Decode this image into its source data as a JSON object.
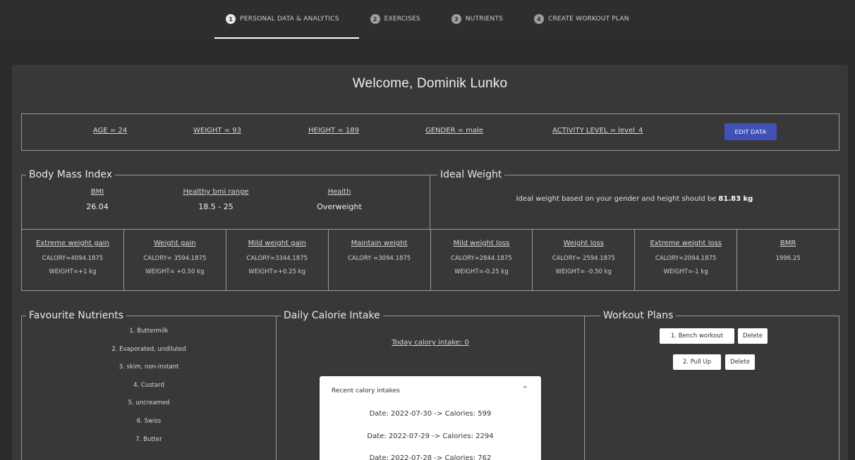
{
  "steps": [
    {
      "num": "1",
      "label": "PERSONAL DATA & ANALYTICS"
    },
    {
      "num": "2",
      "label": "EXERCISES"
    },
    {
      "num": "3",
      "label": "NUTRIENTS"
    },
    {
      "num": "4",
      "label": "CREATE WORKOUT PLAN"
    }
  ],
  "welcome": "Welcome, Dominik Lunko",
  "user": {
    "age": "AGE = 24",
    "weight": "WEIGHT = 93",
    "height": "HEIGHT = 189",
    "gender": "GENDER = male",
    "activity": "ACTIVITY LEVEL = level_4",
    "edit_label": "EDIT DATA"
  },
  "bmi": {
    "legend": "Body Mass Index",
    "bmi_label": "BMI",
    "bmi_value": "26.04",
    "range_label": "Healthy bmi range",
    "range_value": "18.5 - 25",
    "health_label": "Health",
    "health_value": "Overweight"
  },
  "ideal": {
    "legend": "Ideal Weight",
    "text": "Ideal weight based on your gender and height should be",
    "value": "81.83 kg"
  },
  "calories": [
    {
      "title": "Extreme weight gain",
      "calory": "CALORY=4094.1875",
      "weight": "WEIGHT=+1 kg"
    },
    {
      "title": "Weight gain",
      "calory": "CALORY= 3594.1875",
      "weight": "WEIGHT= +0.50 kg"
    },
    {
      "title": "Mild weight gain",
      "calory": "CALORY=3344.1875",
      "weight": "WEIGHT=+0.25 kg"
    },
    {
      "title": "Maintain weight",
      "calory": "CALORY =3094.1875",
      "weight": ""
    },
    {
      "title": "Mild weight loss",
      "calory": "CALORY=2844.1875",
      "weight": "WEIGHT=-0.25 kg"
    },
    {
      "title": "Weight loss",
      "calory": "CALORY= 2594.1875",
      "weight": "WEIGHT= -0.50 kg"
    },
    {
      "title": "Extreme weight loss",
      "calory": "CALORY=2094.1875",
      "weight": "WEIGHT=-1 kg"
    },
    {
      "title": "BMR",
      "calory": "1996.25",
      "weight": ""
    }
  ],
  "nutrients": {
    "legend": "Favourite Nutrients",
    "items": [
      "1. Buttermilk",
      "2. Evaporated, undiluted",
      "3. skim, non-instant",
      "4. Custard",
      "5. uncreamed",
      "6. Swiss",
      "7. Butter"
    ]
  },
  "daily": {
    "legend": "Daily Calorie Intake",
    "today": "Today calory intake: 0",
    "recent_title": "Recent calory intakes",
    "recent": [
      "Date: 2022-07-30 -> Calories: 599",
      "Date: 2022-07-29 -> Calories: 2294",
      "Date: 2022-07-28 -> Calories: 762"
    ]
  },
  "workouts": {
    "legend": "Workout Plans",
    "plans": [
      {
        "name": "1. Bench workout",
        "delete": "Delete"
      },
      {
        "name": "2. Pull Up",
        "delete": "Delete"
      }
    ]
  },
  "colors": {
    "accent": "#3f51b5",
    "background": "#2b2b2b",
    "panel": "#383838"
  }
}
